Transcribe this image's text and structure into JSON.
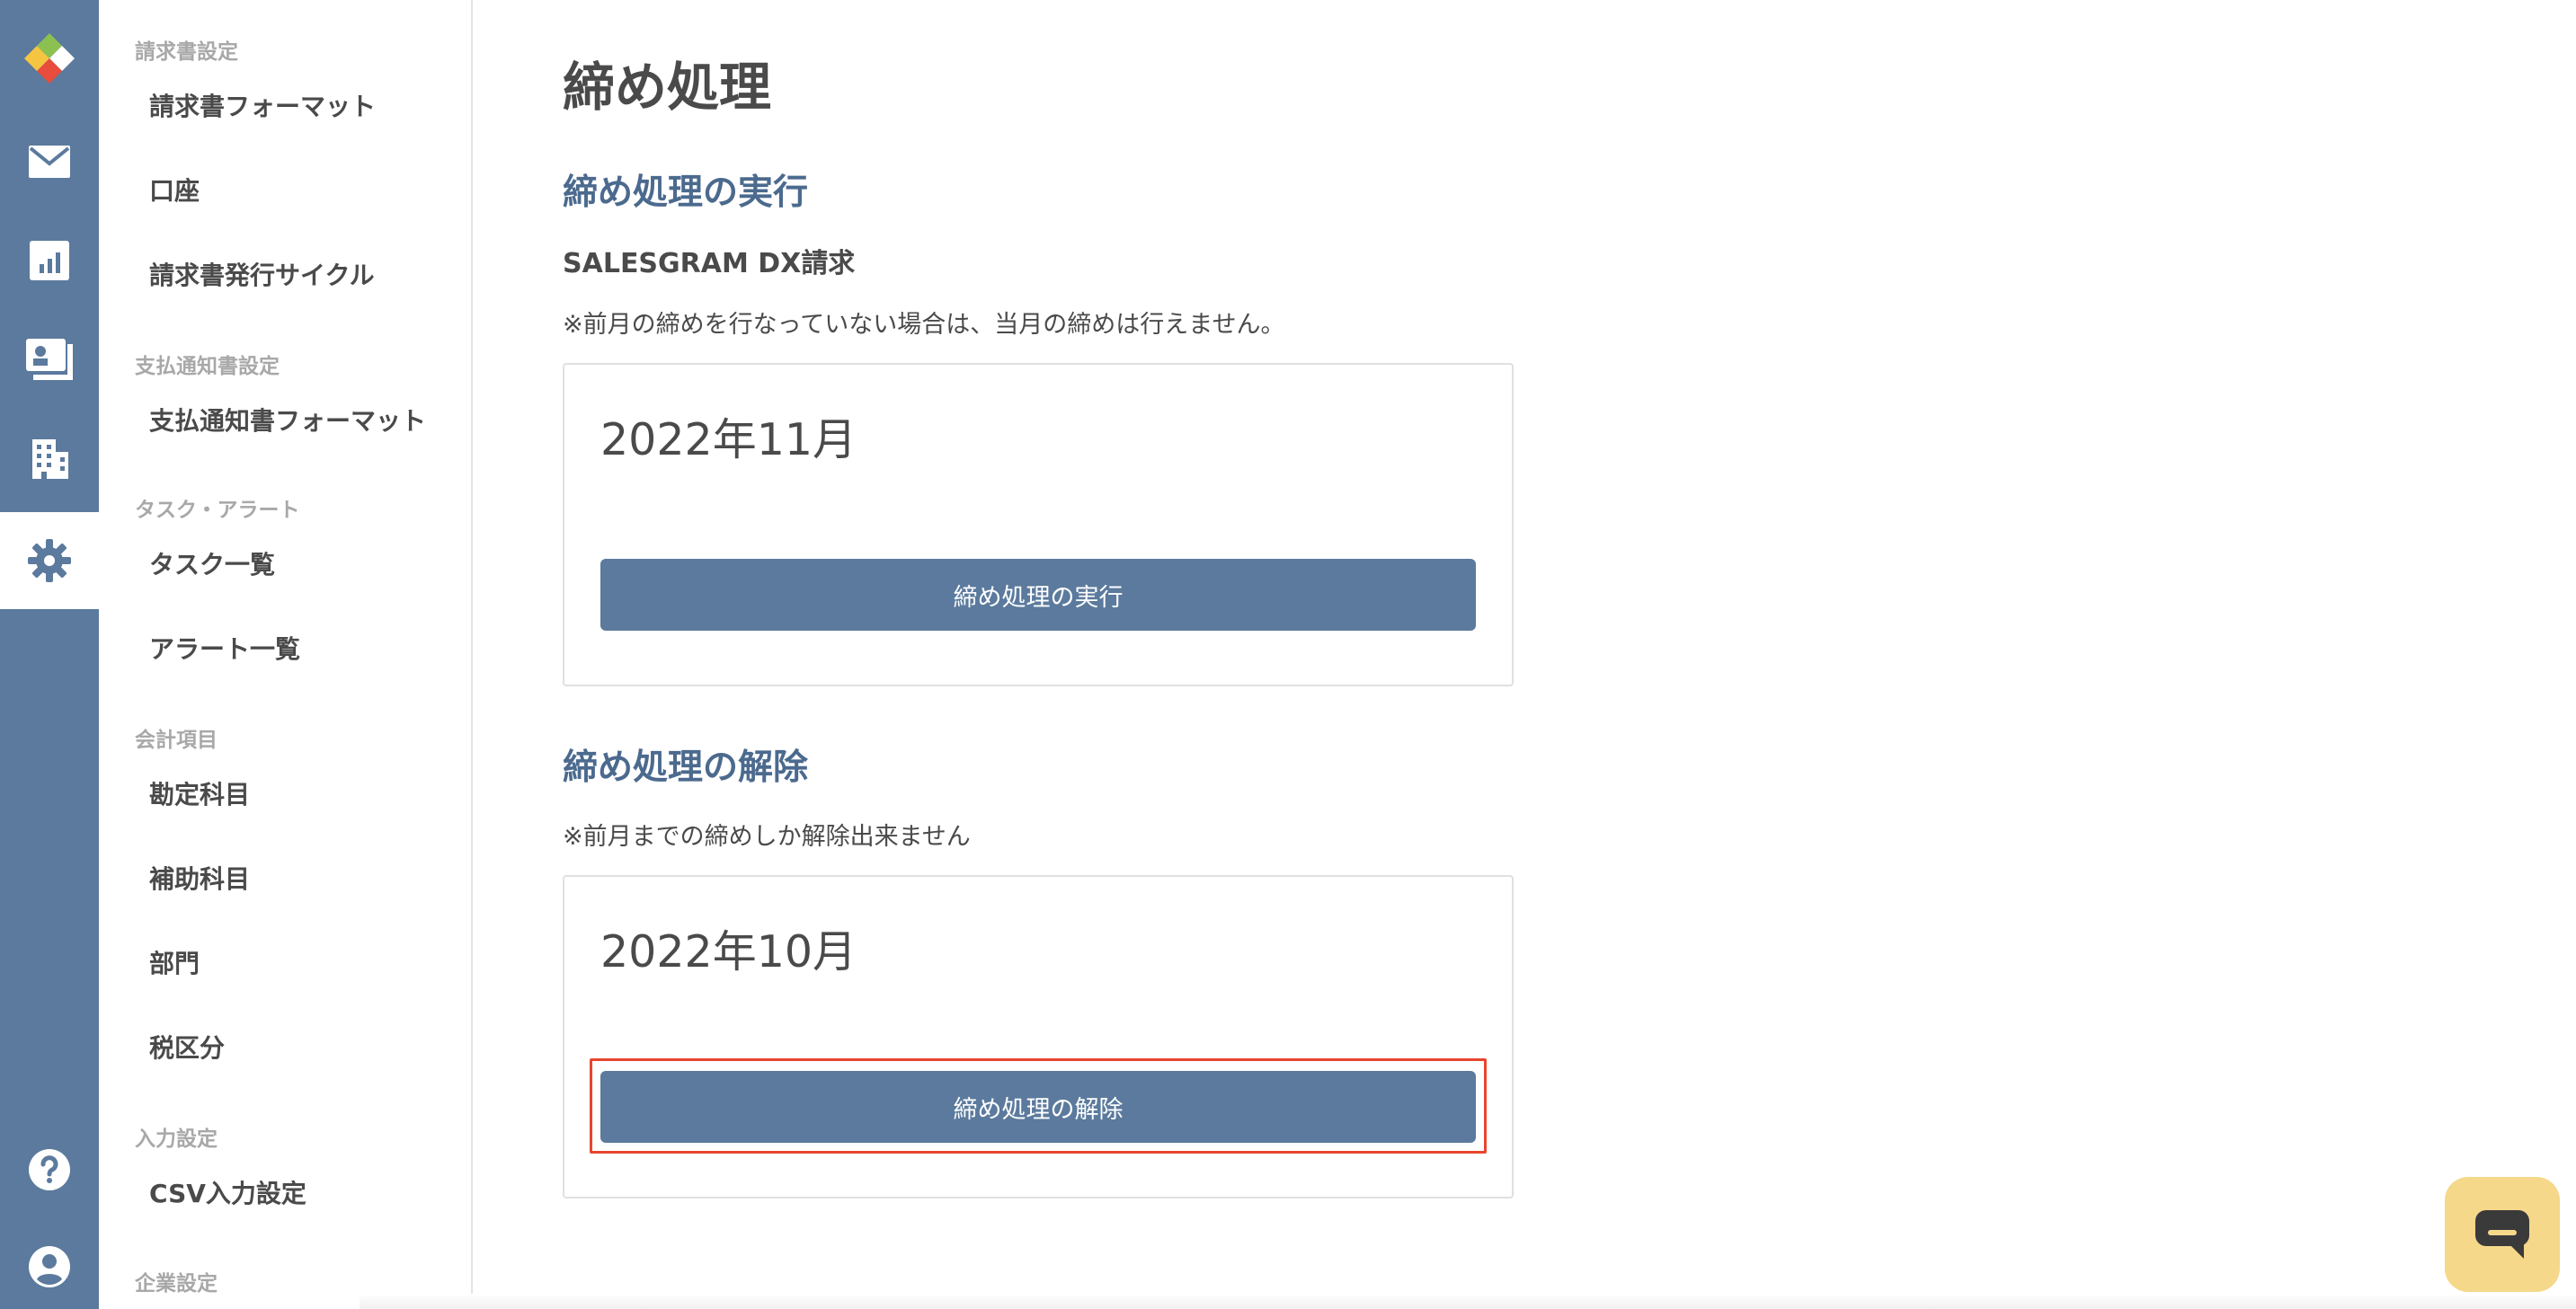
{
  "rail": {
    "items": [
      {
        "icon": "logo-icon"
      },
      {
        "icon": "mail-icon"
      },
      {
        "icon": "chart-icon"
      },
      {
        "icon": "invoice-icon"
      },
      {
        "icon": "building-icon"
      },
      {
        "icon": "gear-icon",
        "active": true
      },
      {
        "icon": "help-icon"
      },
      {
        "icon": "user-icon"
      }
    ],
    "colors": {
      "background": "#5b7a9d",
      "active_background": "#ffffff"
    }
  },
  "sidebar": {
    "sections": [
      {
        "label": "請求書設定",
        "items": [
          "請求書フォーマット",
          "口座",
          "請求書発行サイクル"
        ]
      },
      {
        "label": "支払通知書設定",
        "items": [
          "支払通知書フォーマット"
        ]
      },
      {
        "label": "タスク・アラート",
        "items": [
          "タスク一覧",
          "アラート一覧"
        ]
      },
      {
        "label": "会計項目",
        "items": [
          "勘定科目",
          "補助科目",
          "部門",
          "税区分"
        ]
      },
      {
        "label": "入力設定",
        "items": [
          "CSV入力設定"
        ]
      },
      {
        "label": "企業設定",
        "items": []
      }
    ]
  },
  "main": {
    "title": "締め処理",
    "execute": {
      "heading": "締め処理の実行",
      "product": "SALESGRAM DX請求",
      "note": "※前月の締めを行なっていない場合は、当月の締めは行えません。",
      "month": "2022年11月",
      "button_label": "締め処理の実行"
    },
    "release": {
      "heading": "締め処理の解除",
      "note": "※前月までの締めしか解除出来ません",
      "month": "2022年10月",
      "button_label": "締め処理の解除",
      "highlighted": true
    }
  },
  "colors": {
    "accent": "#5b7a9d",
    "heading": "#4b6a8e",
    "highlight": "#e8452f",
    "chat": "#f5d88a"
  },
  "chat": {
    "icon": "chat-bubble-icon"
  }
}
